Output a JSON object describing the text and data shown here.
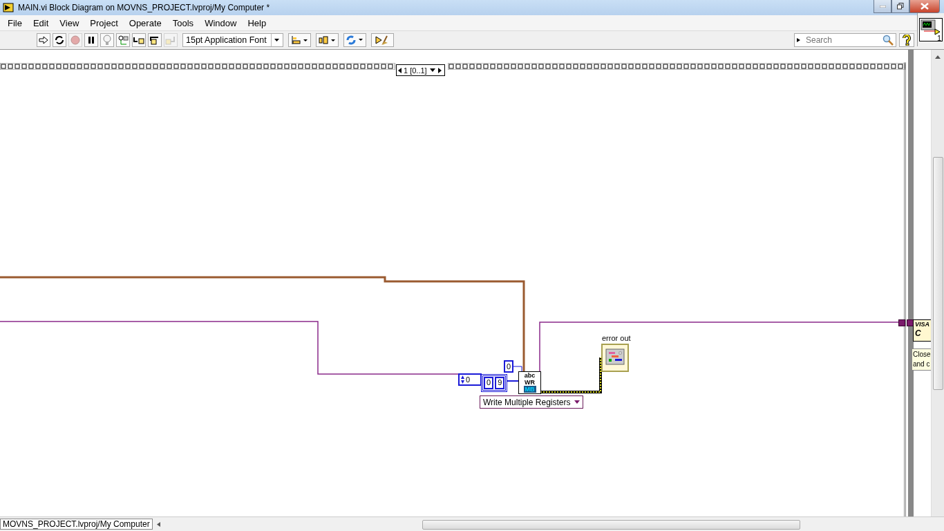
{
  "window": {
    "title": "MAIN.vi Block Diagram on MOVNS_PROJECT.lvproj/My Computer *"
  },
  "menu": [
    "File",
    "Edit",
    "View",
    "Project",
    "Operate",
    "Tools",
    "Window",
    "Help"
  ],
  "toolbar": {
    "left_buttons": [
      {
        "kind": "run",
        "disabled": false
      },
      {
        "kind": "run-continuously",
        "disabled": false
      },
      {
        "kind": "abort",
        "disabled": true
      },
      {
        "kind": "pause",
        "disabled": false
      },
      {
        "kind": "highlight",
        "disabled": false
      },
      {
        "kind": "retain",
        "disabled": false
      },
      {
        "kind": "step-into",
        "disabled": false
      },
      {
        "kind": "step-over",
        "disabled": false
      },
      {
        "kind": "step-out",
        "disabled": true
      }
    ],
    "font": "15pt Application Font",
    "right_buttons": [
      {
        "kind": "align"
      },
      {
        "kind": "distribute"
      },
      {
        "kind": "reorder"
      },
      {
        "kind": "cleanup"
      }
    ],
    "search": {
      "placeholder": "Search"
    }
  },
  "vi_icon": {
    "label": "1"
  },
  "diagram": {
    "sequence_selector": "1 [0..1]",
    "numeric_control": "0",
    "array_constant": [
      "0",
      "9"
    ],
    "numeric_constant": "0",
    "modbus_node": {
      "top": "abc",
      "middle": "WR",
      "bottom": "MB"
    },
    "ring": "Write Multiple Registers",
    "error_indicator": {
      "label": "error out"
    },
    "visa_node": {
      "top": "VISA",
      "bottom": "C"
    },
    "tip_strip": [
      "Close",
      "and c"
    ]
  },
  "status_bar": {
    "path": "MOVNS_PROJECT.lvproj/My Computer"
  }
}
